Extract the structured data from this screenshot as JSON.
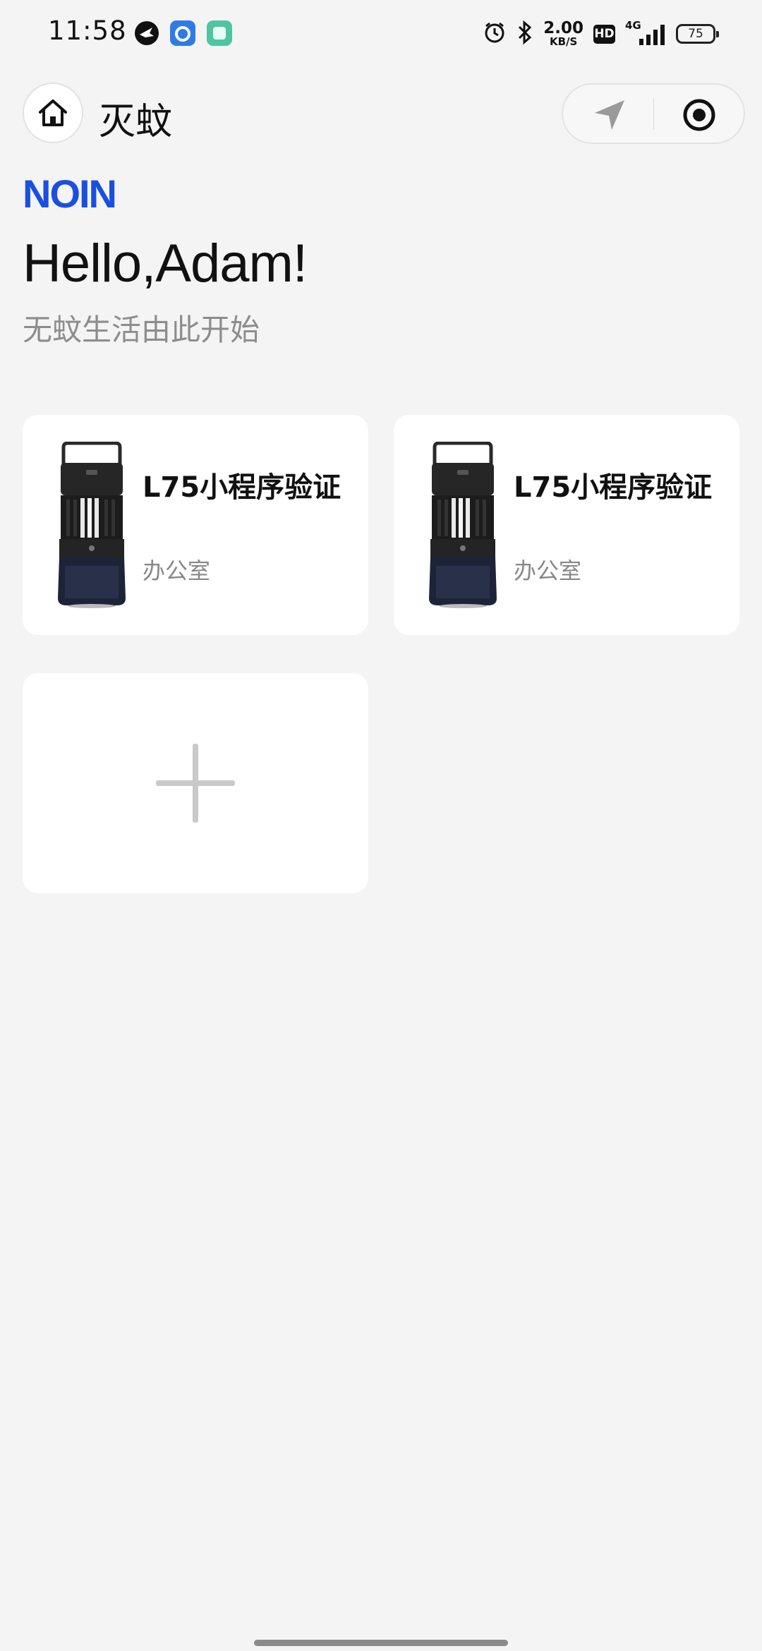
{
  "status_bar": {
    "time": "11:58",
    "net_speed_value": "2.00",
    "net_speed_unit": "KB/S",
    "hd_label": "HD",
    "network_type": "4G",
    "battery_level": "75",
    "app_icons": [
      "bird-app-icon",
      "blue-app-icon",
      "green-app-icon"
    ],
    "indicator_icons": [
      "alarm-icon",
      "bluetooth-icon",
      "signal-icon"
    ]
  },
  "nav": {
    "title": "灭蚊"
  },
  "brand": {
    "logo_text": "NOIN",
    "logo_color": "#1a4fe0"
  },
  "hero": {
    "greeting": "Hello,Adam!",
    "subtitle": "无蚊生活由此开始"
  },
  "devices": [
    {
      "name": "L75小程序验证",
      "room": "办公室"
    },
    {
      "name": "L75小程序验证",
      "room": "办公室"
    }
  ],
  "add_card": {
    "icon": "plus-icon"
  },
  "colors": {
    "background": "#f4f4f4",
    "card": "#ffffff",
    "secondary_text": "#8d8d8d"
  }
}
